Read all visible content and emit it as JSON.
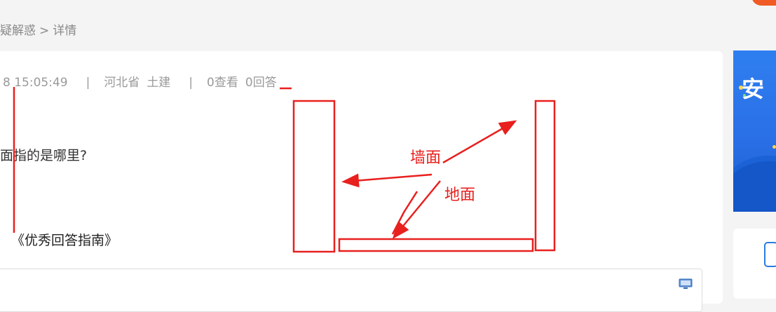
{
  "breadcrumb": {
    "parent": "疑解惑",
    "separator": ">",
    "current": "详情"
  },
  "meta": {
    "datetime": "8 15:05:49",
    "divider": "|",
    "province": "河北省",
    "category": "土建",
    "views": "0查看",
    "answers": "0回答"
  },
  "question": {
    "text": "面指的是哪里?"
  },
  "guide_link": {
    "text": "《优秀回答指南》"
  },
  "annotations": {
    "wall_label": "墙面",
    "floor_label": "地面",
    "color": "#e8201e"
  },
  "banner": {
    "text": "安"
  },
  "icons": {
    "toolbar": "monitor-icon",
    "sidebar_card": "phone-icon"
  },
  "colors": {
    "page_bg": "#f4f4f4",
    "card_bg": "#ffffff",
    "annotation": "#e8201e",
    "banner": "#2f7ff0"
  }
}
